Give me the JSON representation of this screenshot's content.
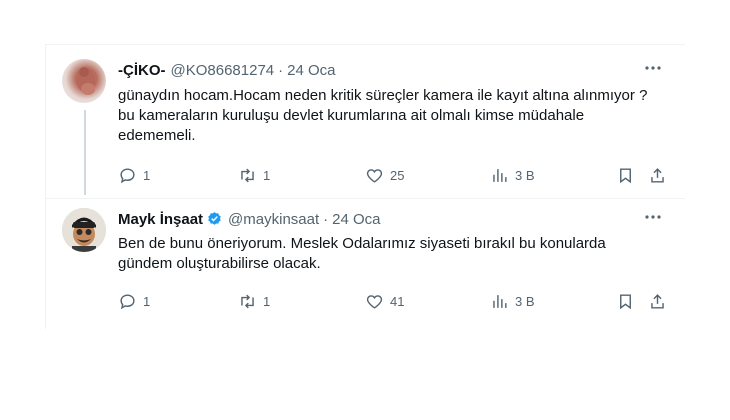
{
  "tweets": [
    {
      "name": "-ÇİKO-",
      "handle": "@KO86681274",
      "separator": "·",
      "date": "24 Oca",
      "verified": false,
      "text": "günaydın hocam.Hocam neden kritik süreçler kamera ile kayıt altına alınmıyor ? bu kameraların kuruluşu devlet kurumlarına ait olmalı kimse müdahale edememeli.",
      "replies": "1",
      "retweets": "1",
      "likes": "25",
      "views": "3 B"
    },
    {
      "name": "Mayk İnşaat",
      "handle": "@maykinsaat",
      "separator": "·",
      "date": "24 Oca",
      "verified": true,
      "text": "Ben de bunu öneriyorum. Meslek Odalarımız siyaseti bırakıl bu konularda gündem oluşturabilirse olacak.",
      "replies": "1",
      "retweets": "1",
      "likes": "41",
      "views": "3 B"
    }
  ],
  "colors": {
    "text": "#0f1419",
    "secondary": "#536471",
    "verified": "#1d9bf0",
    "border": "#eff3f4"
  },
  "icons": [
    "more-icon",
    "reply-icon",
    "retweet-icon",
    "like-icon",
    "views-icon",
    "bookmark-icon",
    "share-icon",
    "verified-badge-icon"
  ]
}
